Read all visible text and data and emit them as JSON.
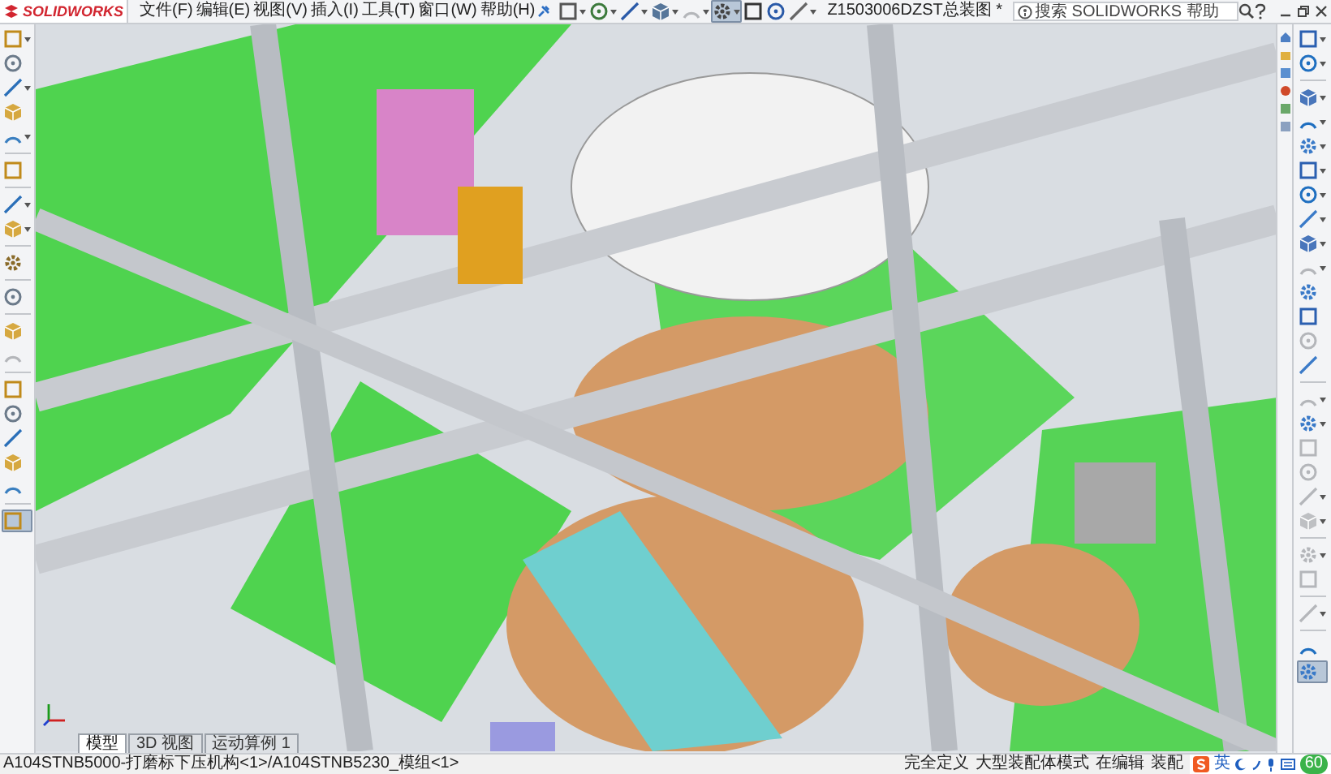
{
  "app": {
    "logo": "SOLIDWORKS"
  },
  "menu": [
    "文件(F)",
    "编辑(E)",
    "视图(V)",
    "插入(I)",
    "工具(T)",
    "窗口(W)",
    "帮助(H)"
  ],
  "top_toolbar": [
    {
      "kind": "tool",
      "dropdown": true,
      "disabled": false,
      "selected": false
    },
    {
      "kind": "tool",
      "dropdown": true,
      "disabled": false,
      "selected": false
    },
    {
      "kind": "tool",
      "dropdown": true,
      "disabled": false,
      "selected": false
    },
    {
      "kind": "tool",
      "dropdown": true,
      "disabled": false,
      "selected": false
    },
    {
      "kind": "tool",
      "dropdown": true,
      "disabled": true,
      "selected": false
    },
    {
      "kind": "tool",
      "dropdown": true,
      "disabled": false,
      "selected": true
    },
    {
      "kind": "tool",
      "dropdown": false,
      "disabled": false,
      "selected": false
    },
    {
      "kind": "tool",
      "dropdown": false,
      "disabled": false,
      "selected": false
    },
    {
      "kind": "tool",
      "dropdown": true,
      "disabled": false,
      "selected": false
    }
  ],
  "window": {
    "title": "Z1503006DZST总装图 *"
  },
  "search": {
    "placeholder": "搜索 SOLIDWORKS 帮助"
  },
  "left_toolbar": [
    {
      "kind": "tool",
      "dropdown": true,
      "disabled": false,
      "selected": false
    },
    {
      "kind": "tool",
      "dropdown": false,
      "disabled": false,
      "selected": false
    },
    {
      "kind": "tool",
      "dropdown": true,
      "disabled": false,
      "selected": false
    },
    {
      "kind": "tool",
      "dropdown": false,
      "disabled": false,
      "selected": false
    },
    {
      "kind": "tool",
      "dropdown": true,
      "disabled": false,
      "selected": false
    },
    {
      "kind": "separator"
    },
    {
      "kind": "tool",
      "dropdown": false,
      "disabled": false,
      "selected": false
    },
    {
      "kind": "separator"
    },
    {
      "kind": "tool",
      "dropdown": true,
      "disabled": false,
      "selected": false
    },
    {
      "kind": "tool",
      "dropdown": true,
      "disabled": false,
      "selected": false
    },
    {
      "kind": "separator"
    },
    {
      "kind": "tool",
      "dropdown": false,
      "disabled": false,
      "selected": false
    },
    {
      "kind": "separator"
    },
    {
      "kind": "tool",
      "dropdown": false,
      "disabled": false,
      "selected": false
    },
    {
      "kind": "separator"
    },
    {
      "kind": "tool",
      "dropdown": false,
      "disabled": false,
      "selected": false
    },
    {
      "kind": "tool",
      "dropdown": false,
      "disabled": true,
      "selected": false
    },
    {
      "kind": "separator"
    },
    {
      "kind": "tool",
      "dropdown": false,
      "disabled": false,
      "selected": false
    },
    {
      "kind": "tool",
      "dropdown": false,
      "disabled": false,
      "selected": false
    },
    {
      "kind": "tool",
      "dropdown": false,
      "disabled": false,
      "selected": false
    },
    {
      "kind": "tool",
      "dropdown": false,
      "disabled": false,
      "selected": false
    },
    {
      "kind": "tool",
      "dropdown": false,
      "disabled": false,
      "selected": false
    },
    {
      "kind": "separator"
    },
    {
      "kind": "tool",
      "dropdown": false,
      "disabled": false,
      "selected": true
    }
  ],
  "right_toolbar": [
    {
      "kind": "tool",
      "dropdown": true,
      "disabled": false,
      "selected": false
    },
    {
      "kind": "tool",
      "dropdown": true,
      "disabled": false,
      "selected": false
    },
    {
      "kind": "separator"
    },
    {
      "kind": "tool",
      "dropdown": true,
      "disabled": false,
      "selected": false
    },
    {
      "kind": "tool",
      "dropdown": true,
      "disabled": false,
      "selected": false
    },
    {
      "kind": "tool",
      "dropdown": true,
      "disabled": false,
      "selected": false
    },
    {
      "kind": "tool",
      "dropdown": true,
      "disabled": false,
      "selected": false
    },
    {
      "kind": "tool",
      "dropdown": true,
      "disabled": false,
      "selected": false
    },
    {
      "kind": "tool",
      "dropdown": true,
      "disabled": false,
      "selected": false
    },
    {
      "kind": "tool",
      "dropdown": true,
      "disabled": false,
      "selected": false
    },
    {
      "kind": "tool",
      "dropdown": true,
      "disabled": true,
      "selected": false
    },
    {
      "kind": "tool",
      "dropdown": false,
      "disabled": false,
      "selected": false
    },
    {
      "kind": "tool",
      "dropdown": false,
      "disabled": false,
      "selected": false
    },
    {
      "kind": "tool",
      "dropdown": false,
      "disabled": true,
      "selected": false
    },
    {
      "kind": "tool",
      "dropdown": false,
      "disabled": false,
      "selected": false
    },
    {
      "kind": "separator"
    },
    {
      "kind": "tool",
      "dropdown": true,
      "disabled": true,
      "selected": false
    },
    {
      "kind": "tool",
      "dropdown": true,
      "disabled": false,
      "selected": false
    },
    {
      "kind": "tool",
      "dropdown": false,
      "disabled": true,
      "selected": false
    },
    {
      "kind": "tool",
      "dropdown": false,
      "disabled": true,
      "selected": false
    },
    {
      "kind": "tool",
      "dropdown": true,
      "disabled": true,
      "selected": false
    },
    {
      "kind": "tool",
      "dropdown": true,
      "disabled": true,
      "selected": false
    },
    {
      "kind": "separator"
    },
    {
      "kind": "tool",
      "dropdown": true,
      "disabled": true,
      "selected": false
    },
    {
      "kind": "tool",
      "dropdown": false,
      "disabled": true,
      "selected": false
    },
    {
      "kind": "separator"
    },
    {
      "kind": "tool",
      "dropdown": true,
      "disabled": true,
      "selected": false
    },
    {
      "kind": "separator"
    },
    {
      "kind": "tool",
      "dropdown": false,
      "disabled": false,
      "selected": false
    },
    {
      "kind": "tool",
      "dropdown": false,
      "disabled": false,
      "selected": true
    }
  ],
  "tabs": [
    {
      "label": "模型",
      "selected": true
    },
    {
      "label": "3D 视图",
      "selected": false
    },
    {
      "label": "运动算例 1",
      "selected": false
    }
  ],
  "status_bar": {
    "path": "A104STNB5000-打磨标下压机构<1>/A104STNB5230_模组<1>",
    "items": [
      "完全定义",
      "大型装配体模式",
      "在编辑",
      "装配"
    ],
    "ime_label": "英",
    "ime_badge": "60"
  }
}
